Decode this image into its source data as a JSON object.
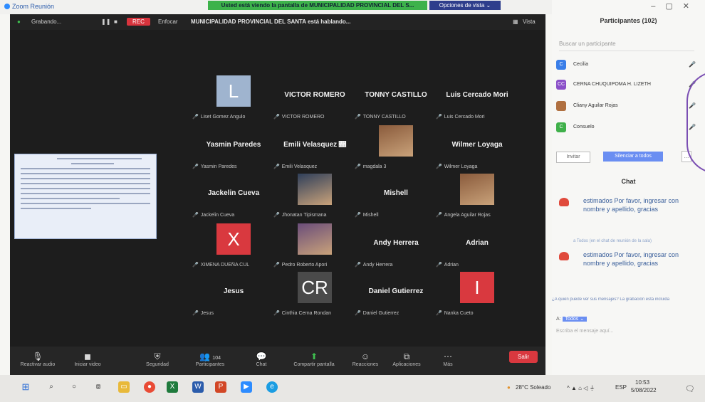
{
  "window": {
    "app_title": "Zoom Reunión",
    "banner": "Usted está viendo la pantalla de MUNICIPALIDAD PROVINCIAL DEL S...",
    "view_options": "Opciones de vista ⌄"
  },
  "meeting_bar": {
    "recording_label": "Grabando...",
    "rec_badge": "REC",
    "speaking": "MUNICIPALIDAD PROVINCIAL DEL SANTA está hablando...",
    "view_label": "Vista",
    "focus_label": "Enfocar"
  },
  "tiles": [
    {
      "name": "",
      "sub": "Liset Gomez Angulo",
      "avatar_letter": "L",
      "avatar_color": "#9fb4cf"
    },
    {
      "name": "VICTOR ROMERO",
      "sub": "VICTOR ROMERO"
    },
    {
      "name": "TONNY CASTILLO",
      "sub": "TONNY CASTILLO"
    },
    {
      "name": "Luis Cercado Mori",
      "sub": "Luis Cercado Mori"
    },
    {
      "name": "Yasmin Paredes",
      "sub": "Yasmin Paredes"
    },
    {
      "name": "Emili  Velasquez 🛛",
      "sub": "Emili Velasquez"
    },
    {
      "name": "",
      "sub": "magdala 3"
    },
    {
      "name": "Wilmer Loyaga",
      "sub": "Wilmer Loyaga"
    },
    {
      "name": "Jackelin Cueva",
      "sub": "Jackelin Cueva"
    },
    {
      "name": "",
      "sub": "Jhonatan Tipismana"
    },
    {
      "name": "Mishell",
      "sub": "Mishell"
    },
    {
      "name": "",
      "sub": "Angela Aguilar Rojas"
    },
    {
      "name": "",
      "sub": "XIMENA DUEÑA CUL",
      "avatar_letter": "X",
      "avatar_color": "#d9393f"
    },
    {
      "name": "",
      "sub": "Pedro Roberto Apori"
    },
    {
      "name": "Andy Herrera",
      "sub": "Andy Herrera"
    },
    {
      "name": "Adrian",
      "sub": "Adrian"
    },
    {
      "name": "Jesus",
      "sub": "Jesus"
    },
    {
      "name": "",
      "sub": "Cinthia Cerna Rondan",
      "avatar_letter": "CR",
      "avatar_color": "#4a4a4a"
    },
    {
      "name": "Daniel Gutierrez",
      "sub": "Daniel Gutierrez"
    },
    {
      "name": "",
      "sub": "Nanka Cueto",
      "avatar_letter": "I",
      "avatar_color": "#d9393f"
    }
  ],
  "toolbar": {
    "audio": "Reactivar audio",
    "video": "Iniciar video",
    "security": "Seguridad",
    "participants": "Participantes",
    "participants_count": "104",
    "chat": "Chat",
    "share": "Compartir pantalla",
    "reactions": "Reacciones",
    "apps": "Aplicaciones",
    "more": "Más",
    "leave": "Salir"
  },
  "panel": {
    "title": "Participantes (102)",
    "search_placeholder": "Buscar un participante",
    "participants": [
      {
        "initial": "C",
        "name": "Cecilia",
        "color": "#3a7ee8"
      },
      {
        "initial": "CC",
        "name": "CERNA CHUQUIPOMA H. LIZETH",
        "color": "#8a4fc8"
      },
      {
        "initial": "",
        "name": "Cliany Aguilar Rojas",
        "color": "#b07040"
      },
      {
        "initial": "C",
        "name": "Consuelo",
        "color": "#3fb04a"
      }
    ],
    "invite": "Invitar",
    "mute_all": "Silenciar a todos",
    "more": "...",
    "chat_title": "Chat",
    "messages": [
      {
        "text": "estimados Por favor, ingresar con nombre y apellido, gracias"
      },
      {
        "text": "estimados Por favor, ingresar con nombre y apellido, gracias"
      }
    ],
    "between_note": "a Todos (en el chat de reunión de la sala)",
    "notice": "¿A quién puede ver sus mensajes? La grabación está incluida",
    "to_label": "A:",
    "to_target": "Todos ⌄",
    "type_placeholder": "Escriba el mensaje aquí..."
  },
  "taskbar": {
    "weather": "28°C Soleado",
    "lang": "ESP",
    "time": "10:53",
    "date": "5/08/2022"
  }
}
